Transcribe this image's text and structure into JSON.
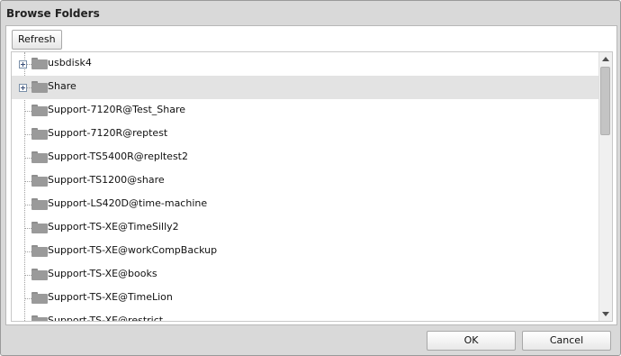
{
  "dialog": {
    "title": "Browse Folders"
  },
  "toolbar": {
    "refresh_label": "Refresh"
  },
  "tree": {
    "items": [
      {
        "label": "usbdisk4",
        "expandable": true,
        "selected": false
      },
      {
        "label": "Share",
        "expandable": true,
        "selected": true
      },
      {
        "label": "Support-7120R@Test_Share",
        "expandable": false,
        "selected": false
      },
      {
        "label": "Support-7120R@reptest",
        "expandable": false,
        "selected": false
      },
      {
        "label": "Support-TS5400R@repltest2",
        "expandable": false,
        "selected": false
      },
      {
        "label": "Support-TS1200@share",
        "expandable": false,
        "selected": false
      },
      {
        "label": "Support-LS420D@time-machine",
        "expandable": false,
        "selected": false
      },
      {
        "label": "Support-TS-XE@TimeSilly2",
        "expandable": false,
        "selected": false
      },
      {
        "label": "Support-TS-XE@workCompBackup",
        "expandable": false,
        "selected": false
      },
      {
        "label": "Support-TS-XE@books",
        "expandable": false,
        "selected": false
      },
      {
        "label": "Support-TS-XE@TimeLion",
        "expandable": false,
        "selected": false
      },
      {
        "label": "Support-TS-XE@restrict",
        "expandable": false,
        "selected": false
      }
    ]
  },
  "footer": {
    "ok_label": "OK",
    "cancel_label": "Cancel"
  }
}
